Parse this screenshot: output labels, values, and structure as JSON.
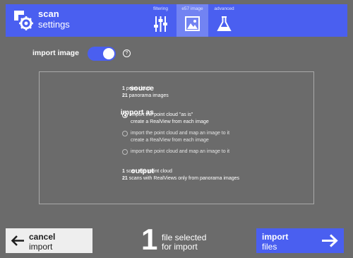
{
  "header": {
    "title_bold": "scan",
    "title_normal": "settings",
    "tabs": [
      {
        "label": "filtering",
        "icon": "sliders-icon"
      },
      {
        "label": "e57 image",
        "icon": "image-icon",
        "selected": true
      },
      {
        "label": "advanced",
        "icon": "flask-icon"
      }
    ]
  },
  "toggle": {
    "label": "import image",
    "on": true,
    "help": "?"
  },
  "source": {
    "label": "source",
    "lines": [
      {
        "count": "1",
        "text": " point cloud"
      },
      {
        "count": "21",
        "text": " panorama images"
      }
    ]
  },
  "import_as": {
    "label": "import as",
    "options": [
      {
        "line1": "import the point cloud \"as is\"",
        "line2": "create a RealView from each image",
        "selected": true
      },
      {
        "line1": "import the point cloud and map an image to it",
        "line2": "create a RealView from each image",
        "selected": false
      },
      {
        "line1": "import the point cloud and map an image to it",
        "line2": "",
        "selected": false
      }
    ]
  },
  "output": {
    "label": "output",
    "lines": [
      {
        "count": "1",
        "text": " scan with point cloud"
      },
      {
        "count": "21",
        "text": " scans with RealViews only from panorama images"
      }
    ]
  },
  "footer": {
    "cancel_bold": "cancel",
    "cancel_normal": "import",
    "count": "1",
    "selected_line1": "file selected",
    "selected_line2": "for import",
    "import_bold": "import",
    "import_normal": "files"
  },
  "colors": {
    "accent": "#4a5ff0",
    "background": "#6b6b6b",
    "tab_selected": "#7283f2"
  }
}
